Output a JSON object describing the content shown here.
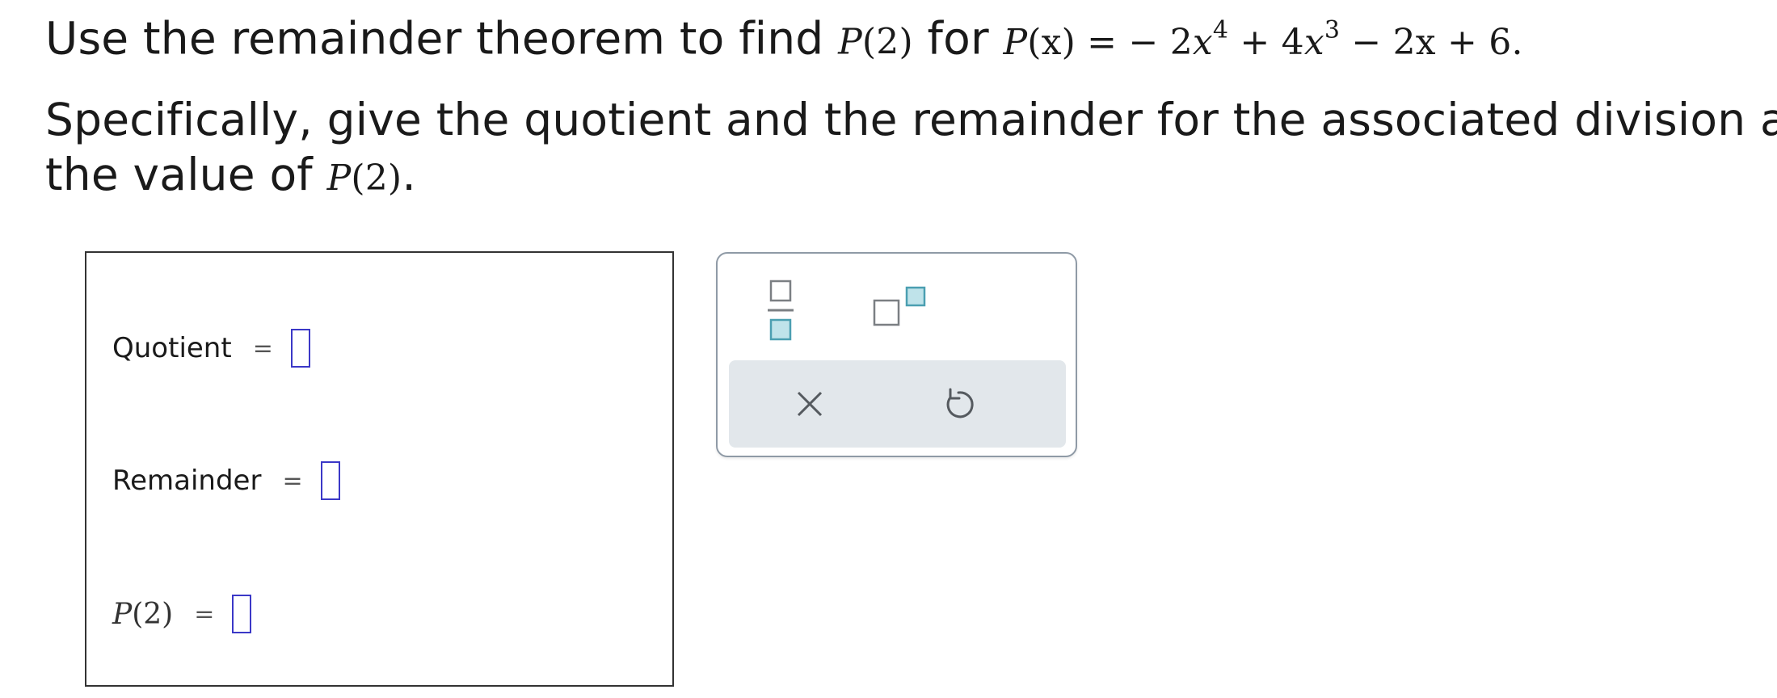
{
  "question": {
    "line1_prefix": "Use the remainder theorem to find ",
    "line1_p": "P",
    "line1_p_arg": "(2)",
    "line1_for": " for ",
    "poly_p": "P",
    "poly_x": "(x)",
    "poly_eq": " = − 2",
    "poly_x1": "x",
    "poly_exp1": "4",
    "poly_mid": " + 4",
    "poly_x2": "x",
    "poly_exp2": "3",
    "poly_tail": " − 2x + 6.",
    "line2": "Specifically, give the quotient and the remainder for the associated division and",
    "line3_prefix": "the value of ",
    "line3_p": "P",
    "line3_p_arg": "(2)",
    "line3_suffix": "."
  },
  "answers": {
    "quotient_label": "Quotient",
    "remainder_label": "Remainder",
    "p_label": "P",
    "p_arg": "(2)",
    "equals": "=",
    "quotient_value": "",
    "remainder_value": "",
    "p2_value": ""
  },
  "toolbar": {
    "icons": [
      "fraction-icon",
      "superscript-icon",
      "close-icon",
      "undo-icon"
    ],
    "accent_fill": "#bfe3ea",
    "accent_stroke": "#4b9fb1",
    "icon_gray": "#7b7f83"
  }
}
